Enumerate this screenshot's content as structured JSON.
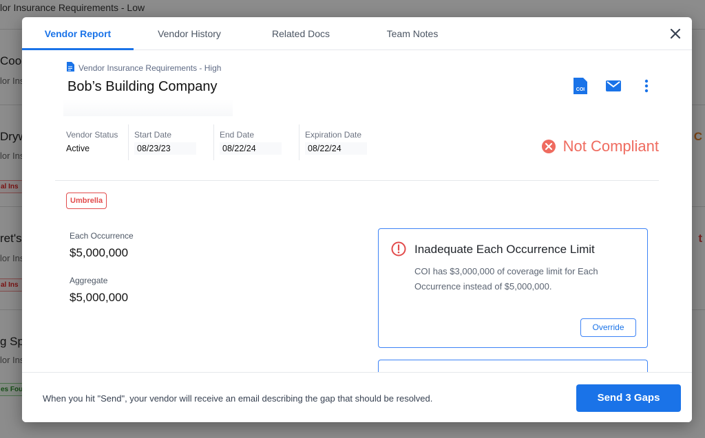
{
  "background": {
    "title": "lor Insurance Requirements - Low",
    "rows": [
      {
        "name": "Cook",
        "sub": "lor Ins"
      },
      {
        "name": "Dryw",
        "sub": "lor Ins",
        "tag": "al Ins"
      },
      {
        "name": "ret's",
        "sub": "lor Ins",
        "tag": "al Ins"
      },
      {
        "name": "g Sp",
        "sub": "lor Ins",
        "tag": "es Fou"
      }
    ],
    "right_marks": [
      "C",
      "t"
    ]
  },
  "tabs": [
    {
      "label": "Vendor Report",
      "active": true
    },
    {
      "label": "Vendor History",
      "active": false
    },
    {
      "label": "Related Docs",
      "active": false
    },
    {
      "label": "Team Notes",
      "active": false
    }
  ],
  "header": {
    "doc_type": "Vendor Insurance Requirements - High",
    "company_name": "Bob’s Building Company",
    "icons": [
      "coi-document-icon",
      "mail-icon",
      "more-vertical-icon"
    ],
    "coi_icon_text": "COI"
  },
  "meta": [
    {
      "label": "Vendor Status",
      "value": "Active"
    },
    {
      "label": "Start Date",
      "value": "08/23/23"
    },
    {
      "label": "End Date",
      "value": "08/22/24"
    },
    {
      "label": "Expiration Date",
      "value": "08/22/24"
    }
  ],
  "status": {
    "text": "Not Compliant",
    "color": "#ef6b5f"
  },
  "coverage": {
    "badge": "Umbrella",
    "limits": [
      {
        "label": "Each Occurrence",
        "value": "$5,000,000"
      },
      {
        "label": "Aggregate",
        "value": "$5,000,000"
      }
    ]
  },
  "gaps": [
    {
      "title": "Inadequate Each Occurrence Limit",
      "description": "COI has $3,000,000 of coverage limit for Each Occurrence instead of $5,000,000.",
      "action": "Override"
    }
  ],
  "footer": {
    "text": "When you hit \"Send\", your vendor will receive an email describing the gap that should be resolved.",
    "send_label": "Send 3 Gaps"
  },
  "colors": {
    "accent": "#1a73e8",
    "danger": "#e24b4b"
  }
}
